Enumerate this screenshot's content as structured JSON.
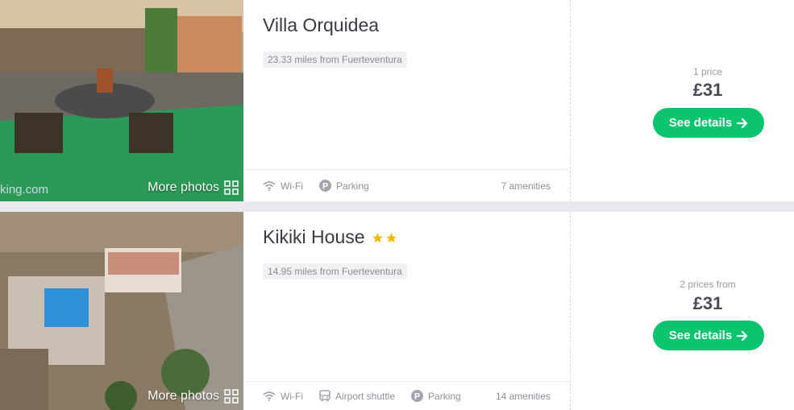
{
  "results": [
    {
      "name": "Villa Orquidea",
      "stars": 0,
      "distance": "23.33 miles from Fuerteventura",
      "amenities": [
        "Wi-Fi",
        "Parking"
      ],
      "amenity_count": "7 amenities",
      "price_label": "1 price",
      "price": "£31",
      "button": "See details",
      "more_photos": "More photos",
      "watermark": "king.com"
    },
    {
      "name": "Kikiki House",
      "stars": 2,
      "distance": "14.95 miles from Fuerteventura",
      "amenities": [
        "Wi-Fi",
        "Airport shuttle",
        "Parking"
      ],
      "amenity_count": "14 amenities",
      "price_label": "2 prices from",
      "price": "£31",
      "button": "See details",
      "more_photos": "More photos"
    }
  ],
  "colors": {
    "accent": "#0dc46e",
    "star": "#f5b800"
  },
  "icons": {
    "wifi": "wifi-icon",
    "parking": "parking-icon",
    "shuttle": "bus-icon",
    "grid": "grid-icon",
    "arrow": "arrow-right-icon",
    "star": "star-icon"
  }
}
